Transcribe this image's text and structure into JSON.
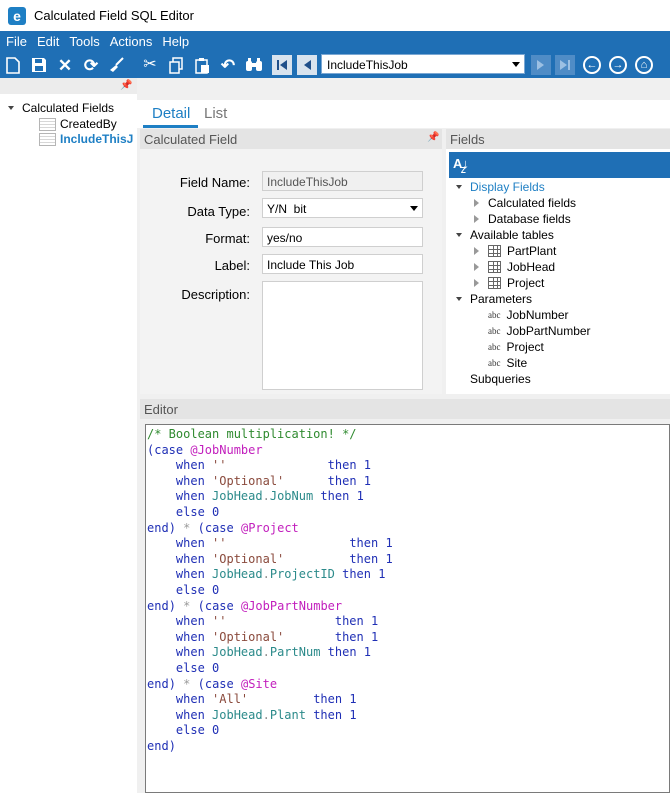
{
  "window": {
    "title": "Calculated Field SQL Editor"
  },
  "menu": [
    "File",
    "Edit",
    "Tools",
    "Actions",
    "Help"
  ],
  "toolbar": {
    "nav_value": "IncludeThisJob"
  },
  "tree": {
    "root": "Calculated Fields",
    "children": [
      "CreatedBy",
      "IncludeThisJ"
    ]
  },
  "tabs": {
    "detail": "Detail",
    "list": "List"
  },
  "calc_field": {
    "header": "Calculated Field",
    "field_name_label": "Field Name:",
    "field_name_value": "IncludeThisJob",
    "data_type_label": "Data Type:",
    "data_type_value": "Y/N  bit",
    "format_label": "Format:",
    "format_value": "yes/no",
    "label_label": "Label:",
    "label_value": "Include This Job",
    "description_label": "Description:"
  },
  "fields": {
    "header": "Fields",
    "display_fields": "Display Fields",
    "calculated_fields": "Calculated fields",
    "database_fields": "Database fields",
    "available_tables": "Available tables",
    "tables": [
      "PartPlant",
      "JobHead",
      "Project"
    ],
    "parameters": "Parameters",
    "abc": "abc",
    "params": [
      "JobNumber",
      "JobPartNumber",
      "Project",
      "Site"
    ],
    "subqueries": "Subqueries"
  },
  "editor": {
    "header": "Editor",
    "code": [
      [
        [
          "cm",
          "/* Boolean multiplication! */"
        ]
      ],
      [
        [
          "kw",
          "("
        ],
        [
          "kw",
          "case "
        ],
        [
          "var",
          "@JobNumber"
        ]
      ],
      [
        [
          "",
          "    "
        ],
        [
          "kw",
          "when "
        ],
        [
          "str",
          "''"
        ],
        [
          "",
          "              "
        ],
        [
          "kw",
          "then "
        ],
        [
          "kw",
          "1"
        ]
      ],
      [
        [
          "",
          "    "
        ],
        [
          "kw",
          "when "
        ],
        [
          "str",
          "'Optional'"
        ],
        [
          "",
          "      "
        ],
        [
          "kw",
          "then "
        ],
        [
          "kw",
          "1"
        ]
      ],
      [
        [
          "",
          "    "
        ],
        [
          "kw",
          "when "
        ],
        [
          "col",
          "JobHead"
        ],
        [
          "dot",
          "."
        ],
        [
          "col",
          "JobNum"
        ],
        [
          "kw",
          " then "
        ],
        [
          "kw",
          "1"
        ]
      ],
      [
        [
          "",
          "    "
        ],
        [
          "kw",
          "else "
        ],
        [
          "kw",
          "0"
        ]
      ],
      [
        [
          "kw",
          "end"
        ],
        [
          "kw",
          ")"
        ],
        [
          "op",
          " * "
        ],
        [
          "kw",
          "("
        ],
        [
          "kw",
          "case "
        ],
        [
          "var",
          "@Project"
        ]
      ],
      [
        [
          "",
          "    "
        ],
        [
          "kw",
          "when "
        ],
        [
          "str",
          "''"
        ],
        [
          "",
          "                 "
        ],
        [
          "kw",
          "then "
        ],
        [
          "kw",
          "1"
        ]
      ],
      [
        [
          "",
          "    "
        ],
        [
          "kw",
          "when "
        ],
        [
          "str",
          "'Optional'"
        ],
        [
          "",
          "         "
        ],
        [
          "kw",
          "then "
        ],
        [
          "kw",
          "1"
        ]
      ],
      [
        [
          "",
          "    "
        ],
        [
          "kw",
          "when "
        ],
        [
          "col",
          "JobHead"
        ],
        [
          "dot",
          "."
        ],
        [
          "col",
          "ProjectID"
        ],
        [
          "kw",
          " then "
        ],
        [
          "kw",
          "1"
        ]
      ],
      [
        [
          "",
          "    "
        ],
        [
          "kw",
          "else "
        ],
        [
          "kw",
          "0"
        ]
      ],
      [
        [
          "kw",
          "end"
        ],
        [
          "kw",
          ")"
        ],
        [
          "op",
          " * "
        ],
        [
          "kw",
          "("
        ],
        [
          "kw",
          "case "
        ],
        [
          "var",
          "@JobPartNumber"
        ]
      ],
      [
        [
          "",
          "    "
        ],
        [
          "kw",
          "when "
        ],
        [
          "str",
          "''"
        ],
        [
          "",
          "               "
        ],
        [
          "kw",
          "then "
        ],
        [
          "kw",
          "1"
        ]
      ],
      [
        [
          "",
          "    "
        ],
        [
          "kw",
          "when "
        ],
        [
          "str",
          "'Optional'"
        ],
        [
          "",
          "       "
        ],
        [
          "kw",
          "then "
        ],
        [
          "kw",
          "1"
        ]
      ],
      [
        [
          "",
          "    "
        ],
        [
          "kw",
          "when "
        ],
        [
          "col",
          "JobHead"
        ],
        [
          "dot",
          "."
        ],
        [
          "col",
          "PartNum"
        ],
        [
          "kw",
          " then "
        ],
        [
          "kw",
          "1"
        ]
      ],
      [
        [
          "",
          "    "
        ],
        [
          "kw",
          "else "
        ],
        [
          "kw",
          "0"
        ]
      ],
      [
        [
          "kw",
          "end"
        ],
        [
          "kw",
          ")"
        ],
        [
          "op",
          " * "
        ],
        [
          "kw",
          "("
        ],
        [
          "kw",
          "case "
        ],
        [
          "var",
          "@Site"
        ]
      ],
      [
        [
          "",
          "    "
        ],
        [
          "kw",
          "when "
        ],
        [
          "str",
          "'All'"
        ],
        [
          "",
          "         "
        ],
        [
          "kw",
          "then "
        ],
        [
          "kw",
          "1"
        ]
      ],
      [
        [
          "",
          "    "
        ],
        [
          "kw",
          "when "
        ],
        [
          "col",
          "JobHead"
        ],
        [
          "dot",
          "."
        ],
        [
          "col",
          "Plant"
        ],
        [
          "kw",
          " then "
        ],
        [
          "kw",
          "1"
        ]
      ],
      [
        [
          "",
          "    "
        ],
        [
          "kw",
          "else "
        ],
        [
          "kw",
          "0"
        ]
      ],
      [
        [
          "kw",
          "end"
        ],
        [
          "kw",
          ")"
        ]
      ]
    ]
  },
  "colors": {
    "accent": "#1f6fb5",
    "selection": "#1e7fc4"
  },
  "icons": [
    "epicor-logo-icon",
    "new-icon",
    "save-icon",
    "delete-icon",
    "refresh-icon",
    "clear-icon",
    "cut-icon",
    "copy-icon",
    "paste-icon",
    "undo-icon",
    "find-icon",
    "first-record-icon",
    "previous-record-icon",
    "next-record-icon",
    "last-record-icon",
    "back-icon",
    "forward-icon",
    "home-icon",
    "pin-icon",
    "sort-az-icon",
    "table-icon"
  ]
}
